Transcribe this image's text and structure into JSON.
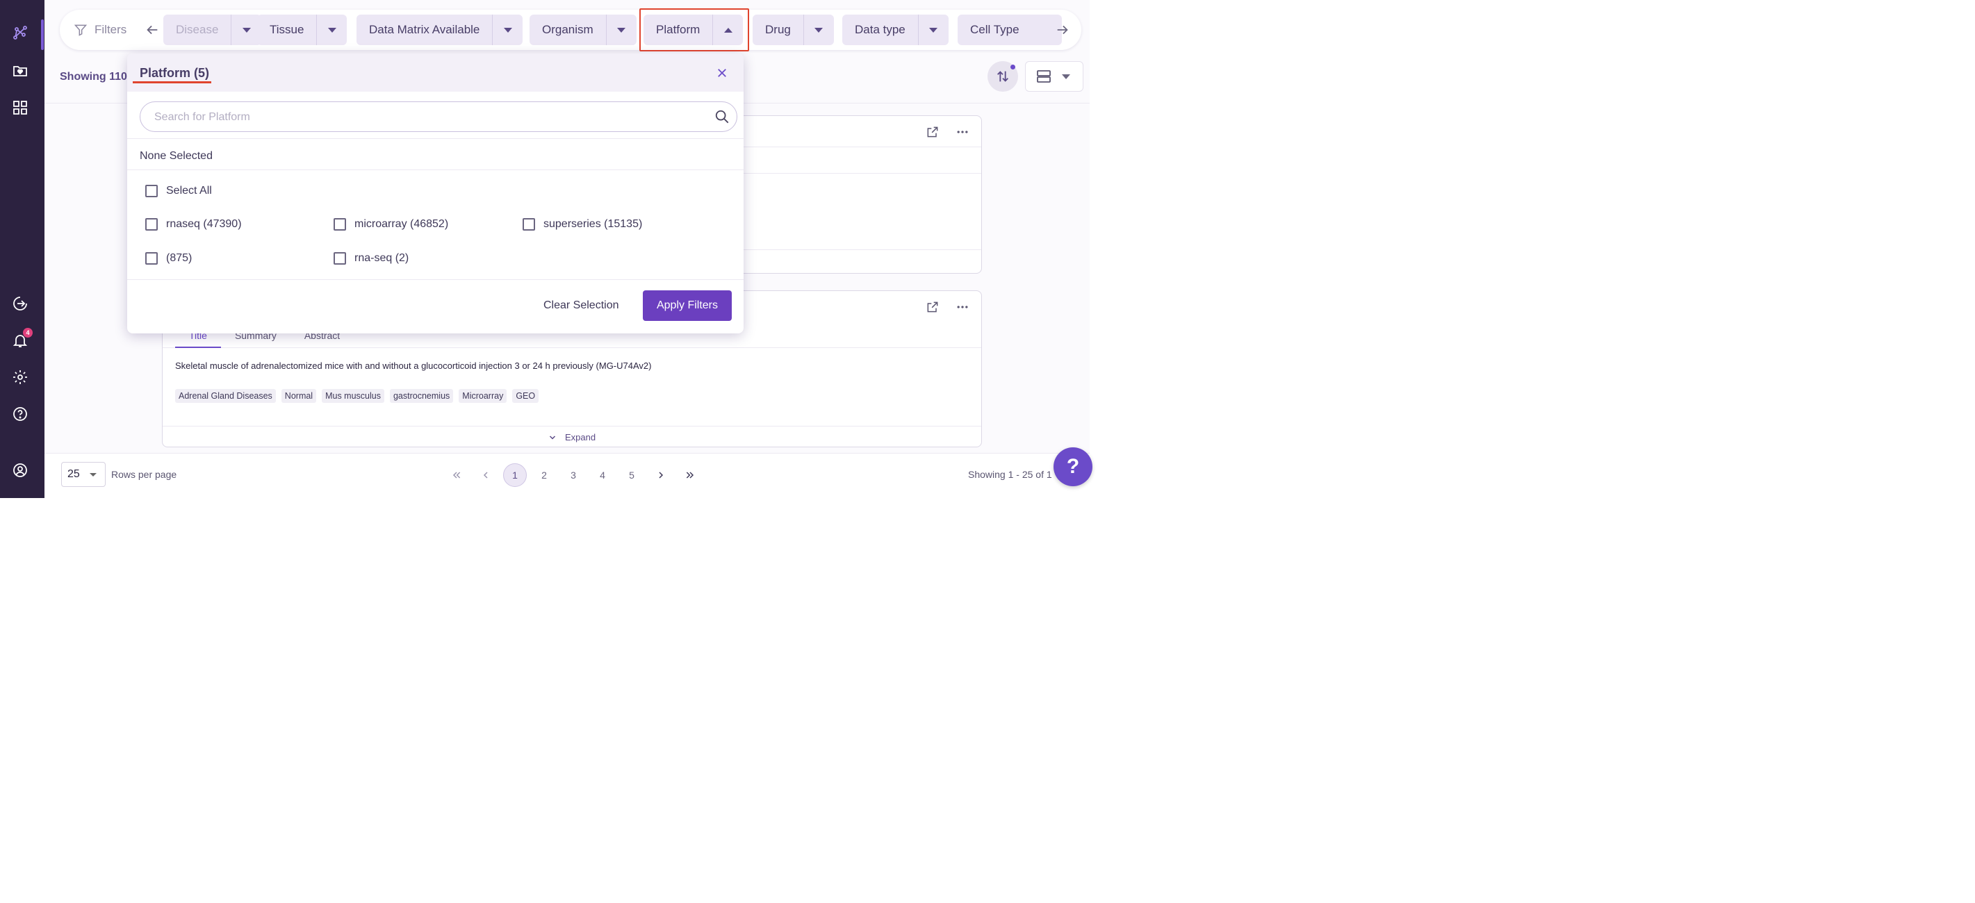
{
  "sidebar": {
    "items": [
      {
        "name": "graph-icon"
      },
      {
        "name": "folder-heart-icon"
      },
      {
        "name": "grid-icon"
      },
      {
        "name": "logout-icon"
      },
      {
        "name": "bell-icon"
      },
      {
        "name": "gear-icon"
      },
      {
        "name": "question-icon"
      },
      {
        "name": "user-icon"
      }
    ],
    "notifications_badge": "4",
    "accent_color": "#7c5cd6"
  },
  "filterbar": {
    "filters_label": "Filters",
    "chips": [
      {
        "label": "Disease",
        "expanded": false
      },
      {
        "label": "Tissue",
        "expanded": false
      },
      {
        "label": "Data Matrix Available",
        "expanded": false
      },
      {
        "label": "Organism",
        "expanded": false
      },
      {
        "label": "Platform",
        "expanded": true
      },
      {
        "label": "Drug",
        "expanded": false
      },
      {
        "label": "Data type",
        "expanded": false
      },
      {
        "label": "Cell Type",
        "expanded": false
      }
    ]
  },
  "results": {
    "showing_text": "Showing 110,"
  },
  "platform_panel": {
    "title": "Platform (5)",
    "search_placeholder": "Search for Platform",
    "search_value": "",
    "selection_status": "None Selected",
    "select_all_label": "Select All",
    "options": [
      {
        "label": "rnaseq (47390)",
        "checked": false
      },
      {
        "label": "microarray (46852)",
        "checked": false
      },
      {
        "label": "superseries (15135)",
        "checked": false
      },
      {
        "label": "(875)",
        "checked": false
      },
      {
        "label": "rna-seq (2)",
        "checked": false
      }
    ],
    "clear_label": "Clear Selection",
    "apply_label": "Apply Filters",
    "apply_color": "#6b3fbf"
  },
  "card2": {
    "tabs": [
      "Title",
      "Summary",
      "Abstract"
    ],
    "active_tab": "Title",
    "title": "Skeletal muscle of adrenalectomized mice with and without a glucocorticoid injection 3 or 24 h previously (MG-U74Av2)",
    "tags": [
      "Adrenal Gland Diseases",
      "Normal",
      "Mus musculus",
      "gastrocnemius",
      "Microarray",
      "GEO"
    ],
    "expand_label": "Expand"
  },
  "pagination": {
    "rows_per_page_value": "25",
    "rows_per_page_label": "Rows per page",
    "pages": [
      "1",
      "2",
      "3",
      "4",
      "5"
    ],
    "current_page": "1",
    "summary": "Showing 1 - 25 of 1"
  },
  "help_button": "?"
}
